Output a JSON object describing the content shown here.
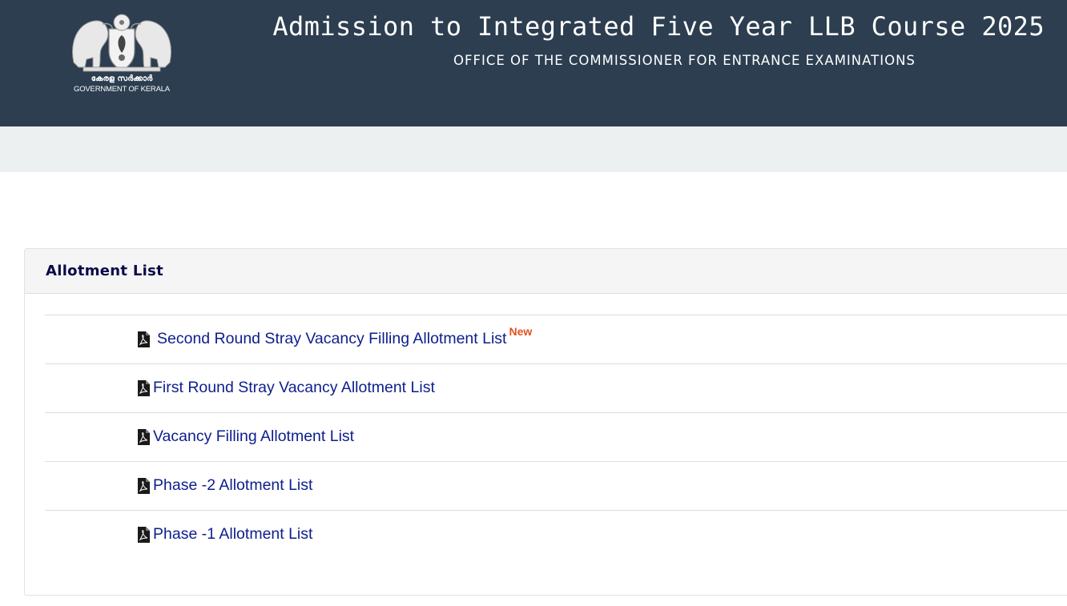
{
  "header": {
    "title": "Admission to Integrated Five Year LLB Course 2025",
    "subtitle": "OFFICE OF THE COMMISSIONER FOR ENTRANCE EXAMINATIONS",
    "emblem": {
      "icon": "kerala-emblem-icon",
      "label_ml": "കേരള സർക്കാർ",
      "label_en": "GOVERNMENT OF KERALA"
    }
  },
  "panel": {
    "title": "Allotment List",
    "items": [
      {
        "label": "Second Round Stray Vacancy Filling Allotment List",
        "badge": "New",
        "icon": "pdf-icon"
      },
      {
        "label": "First Round Stray Vacancy Allotment List",
        "icon": "pdf-icon"
      },
      {
        "label": "Vacancy Filling Allotment List",
        "icon": "pdf-icon"
      },
      {
        "label": "Phase -2 Allotment List",
        "icon": "pdf-icon"
      },
      {
        "label": "Phase -1 Allotment List",
        "icon": "pdf-icon"
      }
    ]
  },
  "colors": {
    "header_bg": "#2c3e50",
    "navbar_bg": "#ecf0f1",
    "panel_title": "#0a0a4a",
    "link": "#0d1e8c",
    "badge": "#e0531f"
  }
}
